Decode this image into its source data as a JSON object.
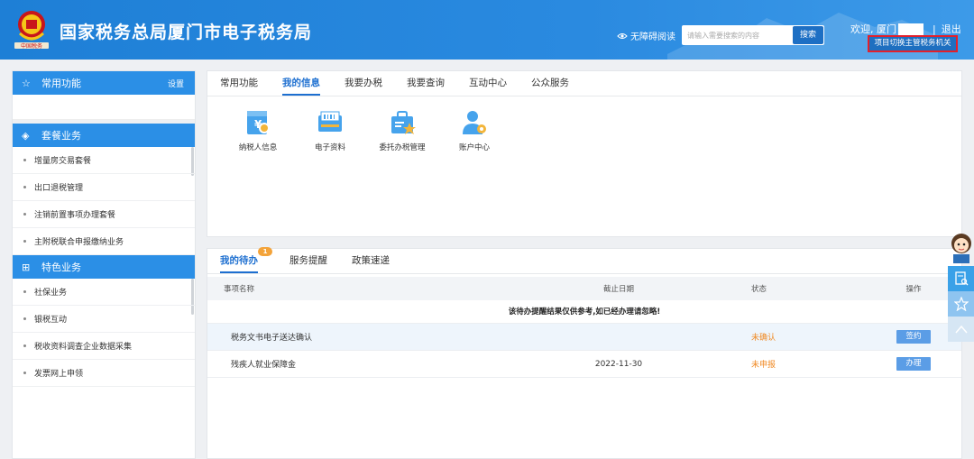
{
  "header": {
    "title": "国家税务总局厦门市电子税务局",
    "emblem_text": "中国税务",
    "accessible_reading": "无障碍阅读",
    "search_placeholder": "请输入需要搜索的内容",
    "search_button": "搜索",
    "welcome_prefix": "欢迎, 厦门",
    "logout": "退出",
    "switch_authority": "项目切换主管税务机关",
    "highlight_color": "#e2202c"
  },
  "sidebar": {
    "common": {
      "title": "常用功能",
      "settings": "设置"
    },
    "package": {
      "title": "套餐业务",
      "items": [
        "增量房交易套餐",
        "出口退税管理",
        "注销前置事项办理套餐",
        "主附税联合申报缴纳业务"
      ]
    },
    "special": {
      "title": "特色业务",
      "items": [
        "社保业务",
        "银税互动",
        "税收资料调查企业数据采集",
        "发票网上申领"
      ]
    }
  },
  "main": {
    "tabs": [
      "常用功能",
      "我的信息",
      "我要办税",
      "我要查询",
      "互动中心",
      "公众服务"
    ],
    "active_tab": "我的信息",
    "functions": [
      {
        "label": "纳税人信息",
        "icon": "taxpayer-info-icon"
      },
      {
        "label": "电子资料",
        "icon": "electronic-documents-icon"
      },
      {
        "label": "委托办税管理",
        "icon": "entrusted-tax-icon"
      },
      {
        "label": "账户中心",
        "icon": "account-center-icon"
      }
    ]
  },
  "todo": {
    "tabs": [
      "我的待办",
      "服务提醒",
      "政策速递"
    ],
    "badge": "1",
    "columns": [
      "事项名称",
      "截止日期",
      "状态",
      "操作"
    ],
    "notice": "该待办提醒结果仅供参考,如已经办理请忽略!",
    "rows": [
      {
        "name": "税务文书电子送达确认",
        "date": "",
        "status": "未确认",
        "action": "签约"
      },
      {
        "name": "残疾人就业保障金",
        "date": "2022-11-30",
        "status": "未申报",
        "action": "办理"
      }
    ]
  },
  "colors": {
    "primary": "#2b8fe6",
    "header": "#1e7fd6",
    "status_orange": "#f08a24",
    "button_blue": "#5b9de6"
  }
}
